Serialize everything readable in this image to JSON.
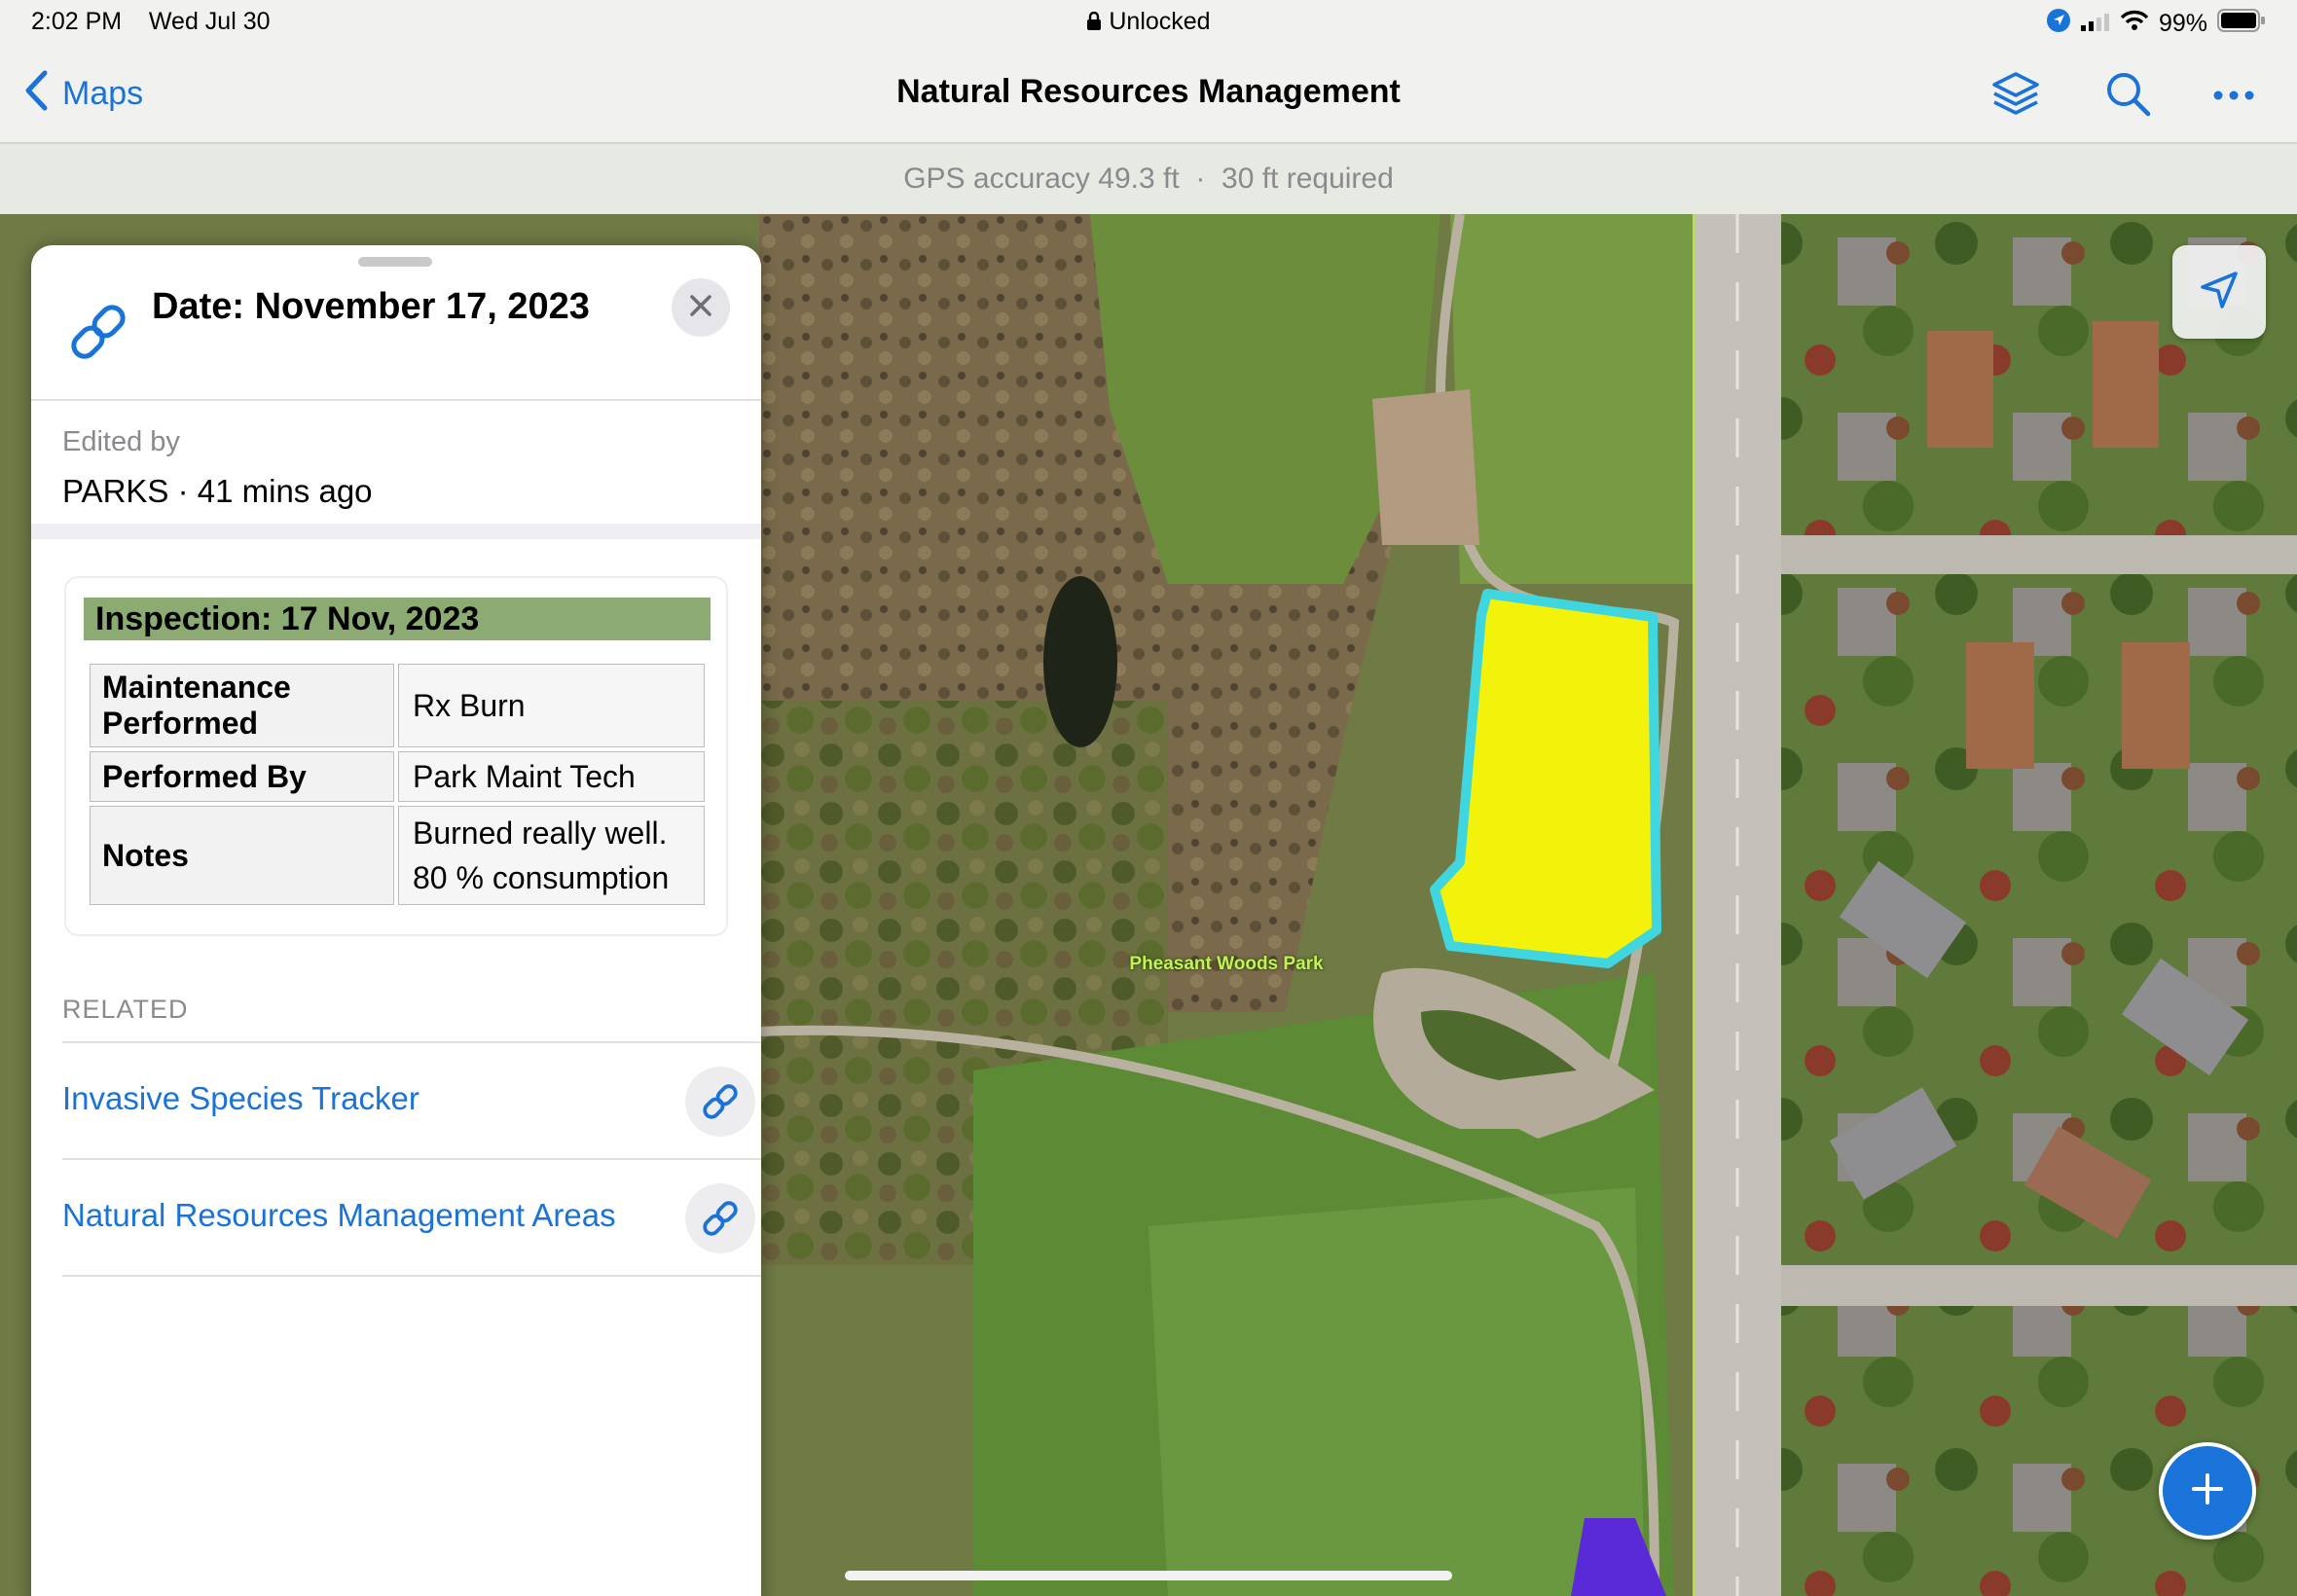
{
  "status_bar": {
    "time": "2:02 PM",
    "date": "Wed Jul 30",
    "lock_text": "Unlocked",
    "battery": "99%"
  },
  "nav": {
    "back_label": "Maps",
    "title": "Natural Resources Management",
    "icons": [
      "layers-icon",
      "search-icon",
      "more-icon"
    ]
  },
  "gps": {
    "accuracy": "GPS accuracy 49.3 ft",
    "separator": "·",
    "required": "30 ft required"
  },
  "panel": {
    "title": "Date: November 17, 2023",
    "edited_label": "Edited by",
    "edited_value": "PARKS · 41 mins ago",
    "inspection": {
      "title": "Inspection: 17 Nov, 2023",
      "rows": [
        {
          "key": "Maintenance Performed",
          "value": "Rx Burn"
        },
        {
          "key": "Performed By",
          "value": "Park Maint Tech"
        },
        {
          "key": "Notes",
          "value": "Burned really well. 80 % consumption"
        }
      ]
    },
    "related_label": "RELATED",
    "related": [
      {
        "label": "Invasive Species Tracker"
      },
      {
        "label": "Natural Resources Management Areas"
      }
    ]
  },
  "map": {
    "park_label": "Pheasant Woods Park",
    "highlight_color": "#f2f20a",
    "outline_color": "#3fd6e0"
  },
  "colors": {
    "accent": "#1a73d9",
    "inspection_header": "#8bab73"
  }
}
